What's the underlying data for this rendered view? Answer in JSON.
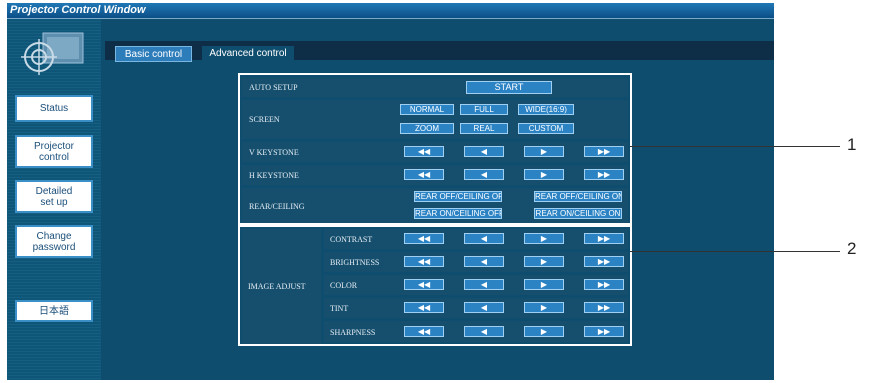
{
  "window": {
    "title": "Projector Control Window"
  },
  "sidebar": {
    "items": [
      {
        "label": "Status"
      },
      {
        "label": "Projector\ncontrol"
      },
      {
        "label": "Detailed\nset up"
      },
      {
        "label": "Change\npassword"
      },
      {
        "label": "日本語"
      }
    ]
  },
  "tabs": [
    {
      "label": "Basic control"
    },
    {
      "label": "Advanced control"
    }
  ],
  "settings": {
    "auto_setup": {
      "label": "AUTO SETUP",
      "button": "START"
    },
    "screen": {
      "label": "SCREEN",
      "options": [
        "NORMAL",
        "FULL",
        "WIDE(16:9)",
        "ZOOM",
        "REAL",
        "CUSTOM"
      ]
    },
    "v_keystone": {
      "label": "V KEYSTONE"
    },
    "h_keystone": {
      "label": "H KEYSTONE"
    },
    "rear_ceiling": {
      "label": "REAR/CEILING",
      "options": [
        "REAR OFF/CEILING OFF",
        "REAR OFF/CEILING ON",
        "REAR ON/CEILING OFF",
        "REAR ON/CEILING ON"
      ]
    },
    "image_adjust": {
      "label": "IMAGE ADJUST",
      "items": [
        "CONTRAST",
        "BRIGHTNESS",
        "COLOR",
        "TINT",
        "SHARPNESS"
      ]
    }
  },
  "arrows": [
    "◀◀",
    "◀",
    "▶",
    "▶▶"
  ],
  "callouts": [
    "1",
    "2"
  ]
}
